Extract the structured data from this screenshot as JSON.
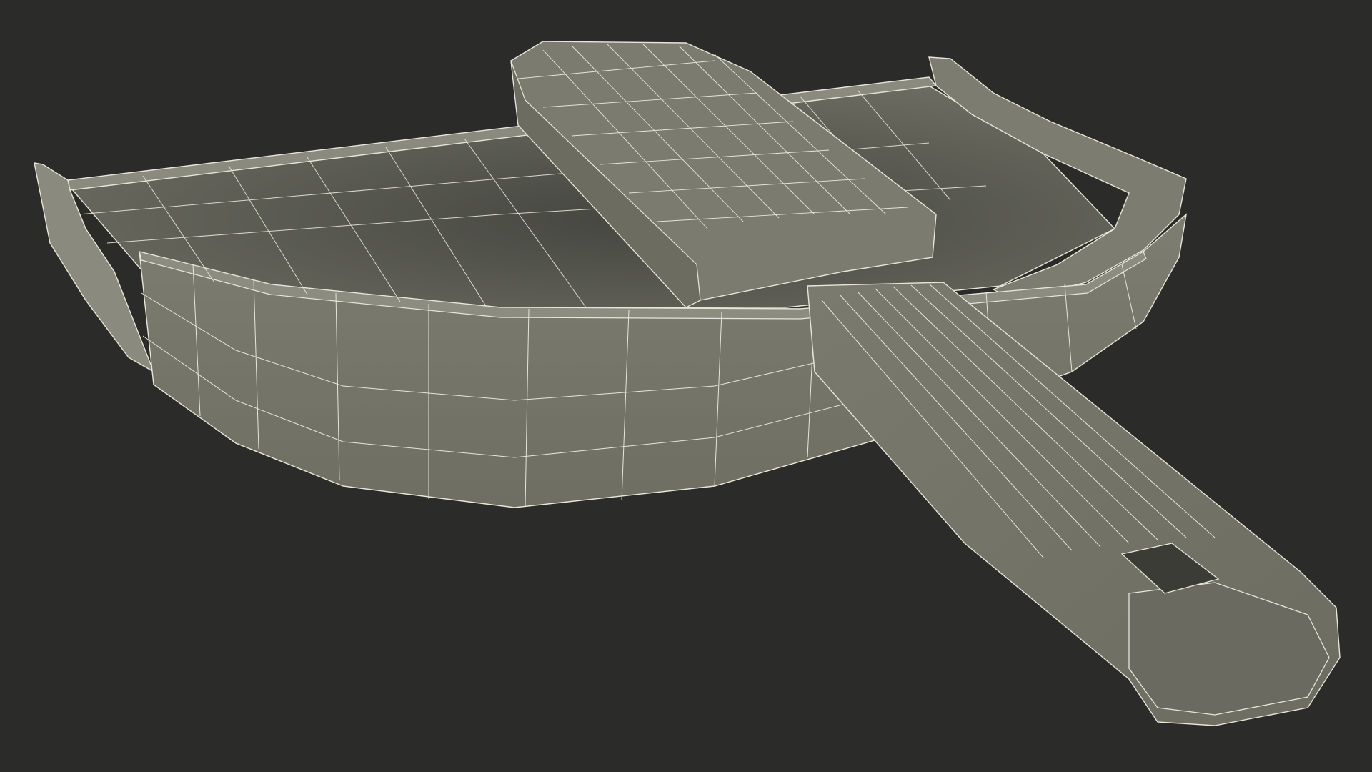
{
  "scene": {
    "subject": "dustpan-wireframe-model",
    "colors": {
      "background": "#2b2b29",
      "surface": "#7a7a6e",
      "surface_dark": "#55564e",
      "surface_shadow": "#45463f",
      "wire": "#e8e6d8"
    }
  }
}
